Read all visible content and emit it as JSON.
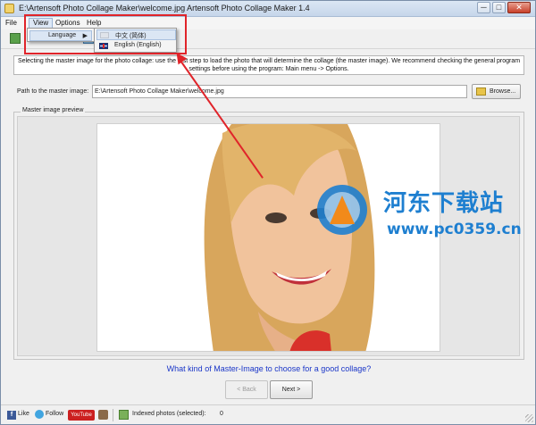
{
  "window": {
    "title": "E:\\Artensoft Photo Collage Maker\\welcome.jpg Artensoft Photo Collage Maker 1.4",
    "controls": {
      "minimize": "─",
      "maximize": "□",
      "close": "✕"
    }
  },
  "menu": {
    "file": "File",
    "view": "View",
    "options": "Options",
    "help": "Help"
  },
  "view_menu": {
    "language": "Language",
    "submenu_arrow": "▶"
  },
  "language_menu": {
    "items": [
      {
        "label": "中文 (简体)",
        "flag_icon": "china-flag-icon",
        "highlighted": true
      },
      {
        "label": "English (English)",
        "flag_icon": "uk-flag-icon",
        "highlighted": false
      }
    ]
  },
  "instructions": "Selecting the master image for the photo collage: use the first step to load the photo that will determine the collage (the master image). We recommend checking the general program settings before using the program: Main menu -> Options.",
  "path": {
    "label": "Path to the master image:",
    "value": "E:\\Artensoft Photo Collage Maker\\welcome.jpg",
    "browse": "Browse..."
  },
  "preview": {
    "legend": "Master image preview"
  },
  "watermark": {
    "site_name": "河东下载站",
    "url": "www.pc0359.cn"
  },
  "help_link": "What kind of Master-Image to choose for a good collage?",
  "navigation": {
    "back": "< Back",
    "next": "Next >",
    "back_enabled": false
  },
  "statusbar": {
    "facebook": "Like",
    "twitter": "Follow",
    "youtube": "YouTube",
    "indexed_label": "Indexed photos (selected):",
    "indexed_count": "0"
  },
  "colors": {
    "annotation_red": "#e0242a",
    "link_blue": "#1a36c8",
    "watermark_blue": "#1e7fd0"
  }
}
